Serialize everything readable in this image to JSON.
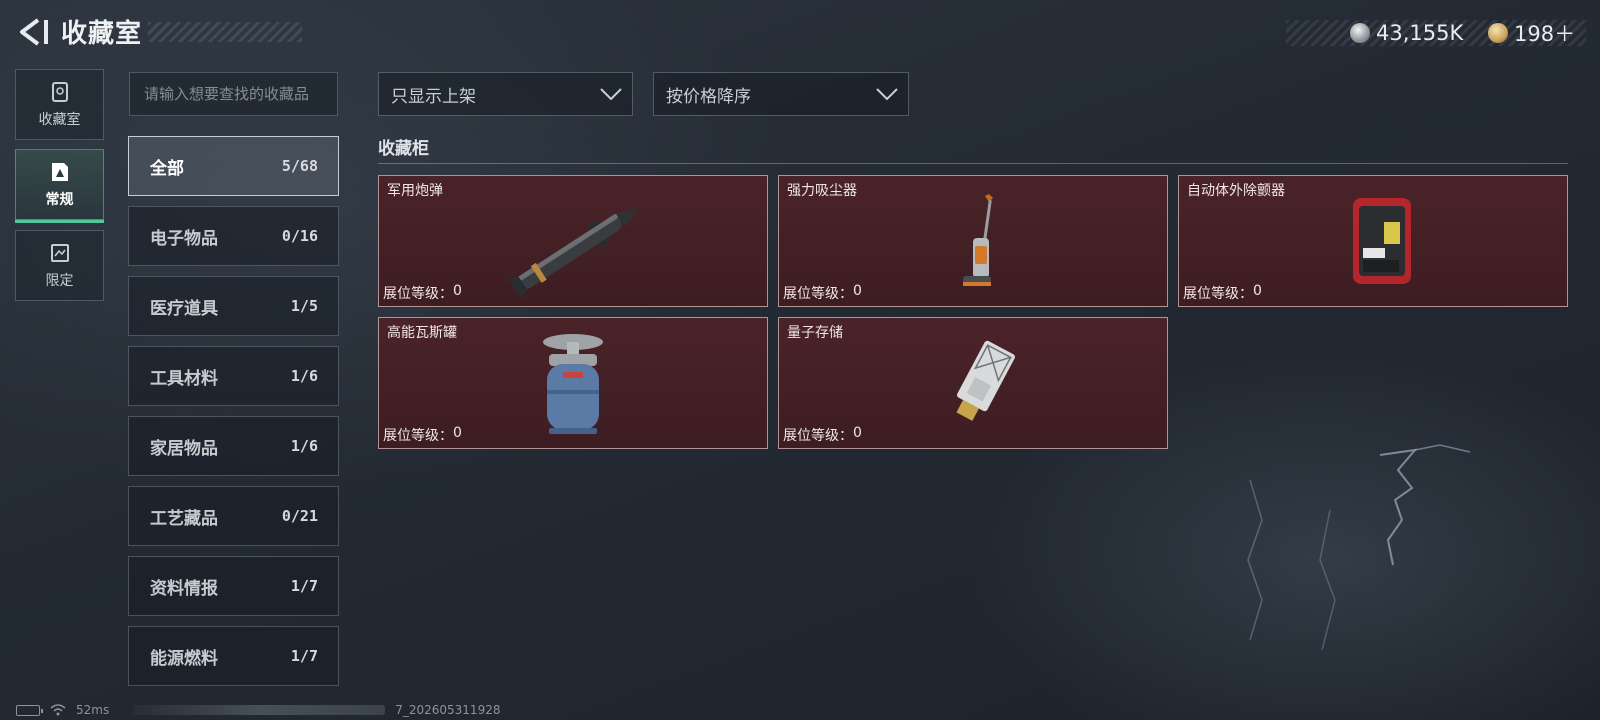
{
  "header": {
    "title": "收藏室",
    "currencies": [
      {
        "icon": "silver-coin-icon",
        "value": "43,155K"
      },
      {
        "icon": "gold-coin-icon",
        "value": "198＋"
      }
    ]
  },
  "sidenav": [
    {
      "label": "收藏室",
      "icon": "collection-room-icon"
    },
    {
      "label": "常规",
      "icon": "regular-icon",
      "active": true
    },
    {
      "label": "限定",
      "icon": "limited-icon"
    }
  ],
  "search": {
    "placeholder": "请输入想要查找的收藏品"
  },
  "categories": [
    {
      "name": "全部",
      "count": "5/68",
      "active": true
    },
    {
      "name": "电子物品",
      "count": "0/16"
    },
    {
      "name": "医疗道具",
      "count": "1/5"
    },
    {
      "name": "工具材料",
      "count": "1/6"
    },
    {
      "name": "家居物品",
      "count": "1/6"
    },
    {
      "name": "工艺藏品",
      "count": "0/21"
    },
    {
      "name": "资料情报",
      "count": "1/7"
    },
    {
      "name": "能源燃料",
      "count": "1/7"
    }
  ],
  "filters": {
    "display": {
      "value": "只显示上架"
    },
    "sort": {
      "value": "按价格降序"
    }
  },
  "section": {
    "title": "收藏柜"
  },
  "items": [
    {
      "name": "军用炮弹",
      "level_label": "展位等级：",
      "level": "0"
    },
    {
      "name": "强力吸尘器",
      "level_label": "展位等级：",
      "level": "0"
    },
    {
      "name": "自动体外除颤器",
      "level_label": "展位等级：",
      "level": "0"
    },
    {
      "name": "高能瓦斯罐",
      "level_label": "展位等级：",
      "level": "0"
    },
    {
      "name": "量子存储",
      "level_label": "展位等级：",
      "level": "0"
    }
  ],
  "footer": {
    "ping": "52ms",
    "build": "7_202605311928"
  },
  "colors": {
    "accent": "#4fc99a",
    "card_bg": "#4a2328",
    "card_border": "#d7b9b9"
  }
}
